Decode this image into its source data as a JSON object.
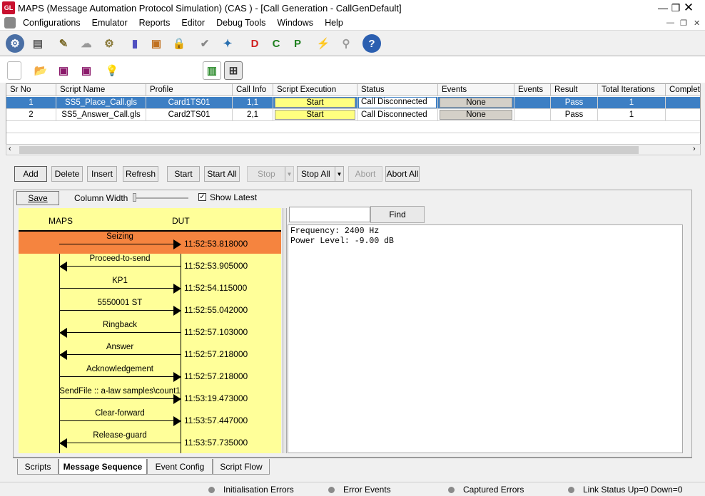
{
  "window": {
    "title": "MAPS (Message Automation Protocol Simulation)  (CAS ) - [Call Generation  - CallGenDefault]",
    "logo": "GL"
  },
  "menu": [
    "Configurations",
    "Emulator",
    "Reports",
    "Editor",
    "Debug Tools",
    "Windows",
    "Help"
  ],
  "table": {
    "headers": [
      "Sr No",
      "Script Name",
      "Profile",
      "Call Info",
      "Script Execution",
      "Status",
      "Events",
      "Events",
      "Result",
      "Total Iterations",
      "Complete"
    ],
    "rows": [
      {
        "sr": "1",
        "script": "SS5_Place_Call.gls",
        "profile": "Card1TS01",
        "callinfo": "1,1",
        "exec": "Start",
        "status": "Call Disconnected",
        "events": "None",
        "events2": "",
        "result": "Pass",
        "iterations": "1",
        "complete": ""
      },
      {
        "sr": "2",
        "script": "SS5_Answer_Call.gls",
        "profile": "Card2TS01",
        "callinfo": "2,1",
        "exec": "Start",
        "status": "Call Disconnected",
        "events": "None",
        "events2": "",
        "result": "Pass",
        "iterations": "1",
        "complete": ""
      }
    ]
  },
  "actions": {
    "add": "Add",
    "delete": "Delete",
    "insert": "Insert",
    "refresh": "Refresh",
    "start": "Start",
    "start_all": "Start All",
    "stop": "Stop",
    "stop_all": "Stop All",
    "abort": "Abort",
    "abort_all": "Abort All"
  },
  "sequence": {
    "save": "Save",
    "column_width": "Column Width",
    "show_latest": "Show Latest",
    "col_left": "MAPS",
    "col_right": "DUT",
    "messages": [
      {
        "label": "Seizing",
        "time": "11:52:53.818000",
        "dir": "right",
        "selected": true
      },
      {
        "label": "Proceed-to-send",
        "time": "11:52:53.905000",
        "dir": "left"
      },
      {
        "label": "KP1",
        "time": "11:52:54.115000",
        "dir": "right"
      },
      {
        "label": "5550001 ST",
        "time": "11:52:55.042000",
        "dir": "right"
      },
      {
        "label": "Ringback",
        "time": "11:52:57.103000",
        "dir": "left"
      },
      {
        "label": "Answer",
        "time": "11:52:57.218000",
        "dir": "left"
      },
      {
        "label": "Acknowledgement",
        "time": "11:52:57.218000",
        "dir": "right"
      },
      {
        "label": "SendFile :: a-law samples\\count1",
        "time": "11:53:19.473000",
        "dir": "right"
      },
      {
        "label": "Clear-forward",
        "time": "11:53:57.447000",
        "dir": "right"
      },
      {
        "label": "Release-guard",
        "time": "11:53:57.735000",
        "dir": "left"
      }
    ],
    "find": "Find",
    "detail_lines": [
      "Frequency: 2400 Hz",
      "Power Level: -9.00 dB"
    ]
  },
  "tabs": [
    "Scripts",
    "Message Sequence",
    "Event Config",
    "Script Flow"
  ],
  "active_tab": "Message Sequence",
  "status": [
    "Initialisation Errors",
    "Error Events",
    "Captured Errors",
    "Link Status Up=0 Down=0"
  ],
  "colors": {
    "selected_row": "#3d7fc4",
    "selected_msg": "#f5843f",
    "ladder_bg": "#ffff99"
  }
}
